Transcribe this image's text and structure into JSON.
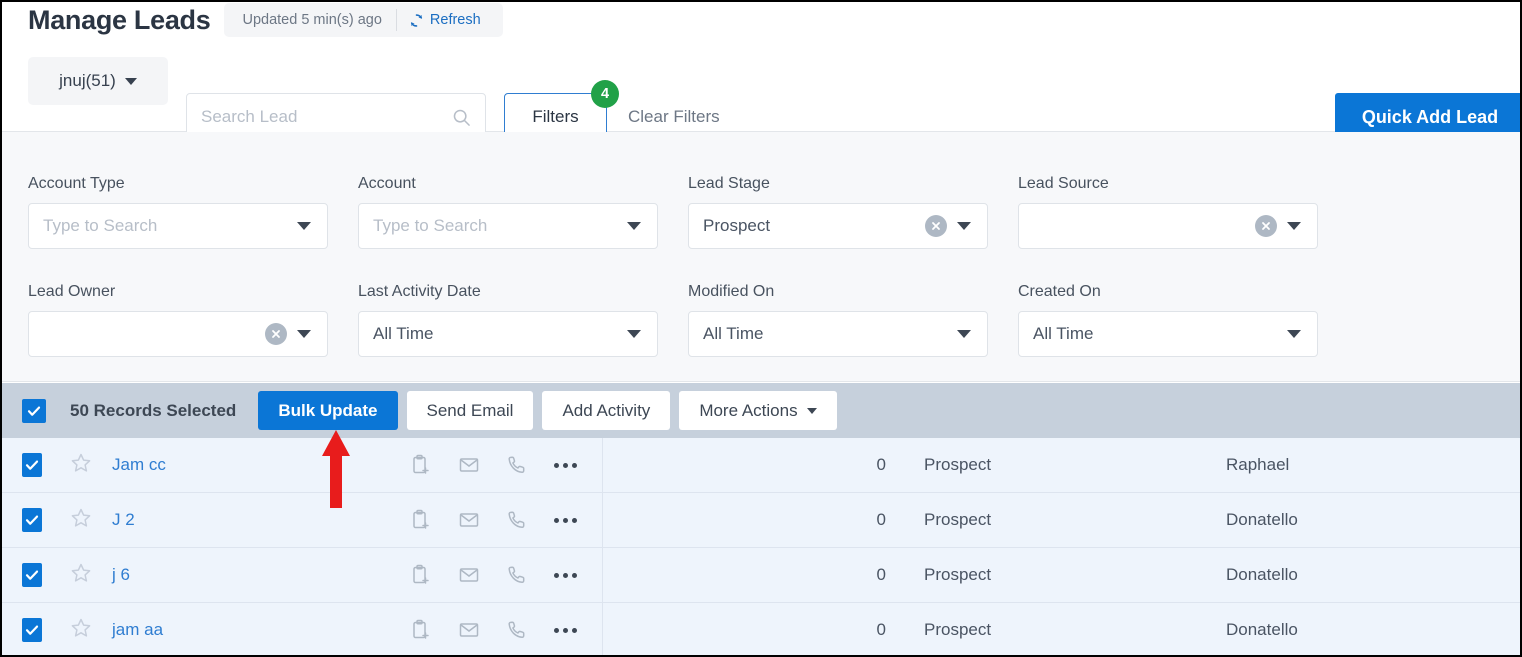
{
  "header": {
    "title": "Manage Leads",
    "updated_text": "Updated 5 min(s) ago",
    "refresh_label": "Refresh",
    "refresh_icon": "refresh-icon"
  },
  "toolbar": {
    "view_select_label": "jnuj(51)",
    "search_placeholder": "Search Lead",
    "search_value": "",
    "search_icon": "search-icon",
    "filters_label": "Filters",
    "filters_badge_count": "4",
    "clear_filters_label": "Clear Filters",
    "quick_add_label": "Quick Add Lead"
  },
  "filters": [
    {
      "label": "Account Type",
      "value": "Type to Search",
      "is_placeholder": true,
      "has_clear": false
    },
    {
      "label": "Account",
      "value": "Type to Search",
      "is_placeholder": true,
      "has_clear": false
    },
    {
      "label": "Lead Stage",
      "value": "Prospect",
      "is_placeholder": false,
      "has_clear": true
    },
    {
      "label": "Lead Source",
      "value": "",
      "is_placeholder": false,
      "has_clear": true
    },
    {
      "label": "Lead Owner",
      "value": "",
      "is_placeholder": false,
      "has_clear": true
    },
    {
      "label": "Last Activity Date",
      "value": "All Time",
      "is_placeholder": false,
      "has_clear": false
    },
    {
      "label": "Modified On",
      "value": "All Time",
      "is_placeholder": false,
      "has_clear": false
    },
    {
      "label": "Created On",
      "value": "All Time",
      "is_placeholder": false,
      "has_clear": false
    }
  ],
  "bulk_bar": {
    "select_all_checked": true,
    "records_selected_text": "50 Records Selected",
    "primary_action": "Bulk Update",
    "actions": [
      "Send Email",
      "Add Activity"
    ],
    "more_actions_label": "More Actions"
  },
  "table": {
    "rows": [
      {
        "checked": true,
        "starred": false,
        "name": "Jam cc",
        "count": "0",
        "stage": "Prospect",
        "owner": "Raphael"
      },
      {
        "checked": true,
        "starred": false,
        "name": "J 2",
        "count": "0",
        "stage": "Prospect",
        "owner": "Donatello"
      },
      {
        "checked": true,
        "starred": false,
        "name": "j 6",
        "count": "0",
        "stage": "Prospect",
        "owner": "Donatello"
      },
      {
        "checked": true,
        "starred": false,
        "name": "jam aa",
        "count": "0",
        "stage": "Prospect",
        "owner": "Donatello"
      }
    ],
    "row_action_icons": [
      "add-task-icon",
      "email-icon",
      "call-icon",
      "more-options-icon"
    ]
  },
  "annotation": {
    "type": "arrow-up",
    "target": "Bulk Update",
    "color": "#e81c1c"
  },
  "colors": {
    "accent_blue": "#0b76d6",
    "link_blue": "#2f7dd1",
    "badge_green": "#21a148",
    "bulk_bar_bg": "#c6d0dc",
    "row_selected_bg": "#eef4fc",
    "filter_panel_bg": "#f7f8fa",
    "annotation_red": "#e81c1c"
  }
}
